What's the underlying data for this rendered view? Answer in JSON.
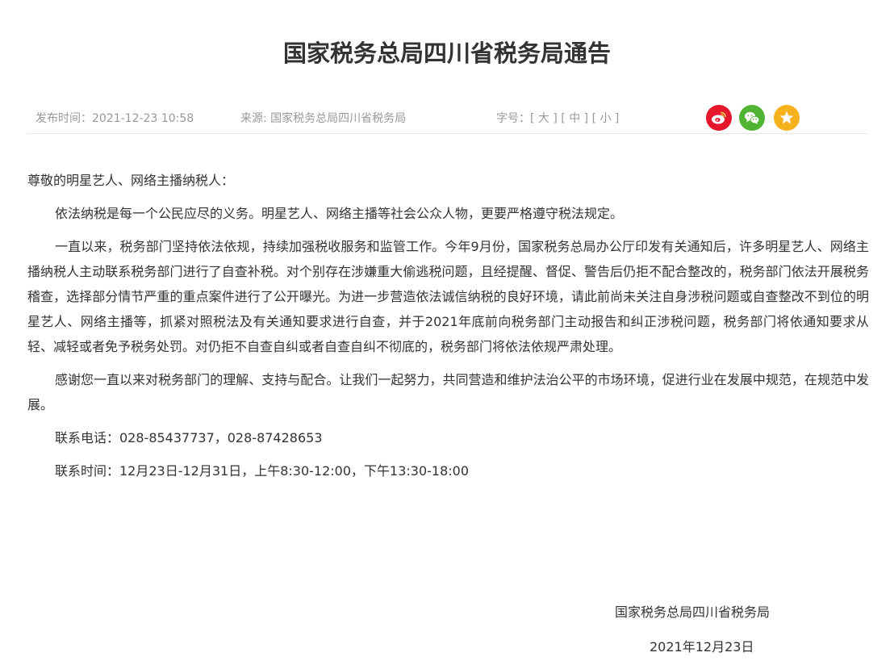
{
  "article": {
    "title": "国家税务总局四川省税务局通告"
  },
  "meta": {
    "publish_label": "发布时间：",
    "publish_time": "2021-12-23 10:58",
    "source_label": "来源: ",
    "source": "国家税务总局四川省税务局",
    "font_size_label": "字号：",
    "size_large": "[ 大 ]",
    "size_medium": "[ 中 ]",
    "size_small": "[ 小 ]"
  },
  "share": {
    "weibo_icon": "weibo-icon",
    "wechat_icon": "wechat-icon",
    "favorite_icon": "star-icon",
    "colors": {
      "weibo": "#e6162d",
      "wechat": "#51b332",
      "favorite": "#f5b21d"
    }
  },
  "body": {
    "greeting": "尊敬的明星艺人、网络主播纳税人：",
    "p1": "依法纳税是每一个公民应尽的义务。明星艺人、网络主播等社会公众人物，更要严格遵守税法规定。",
    "p2": "一直以来，税务部门坚持依法依规，持续加强税收服务和监管工作。今年9月份，国家税务总局办公厅印发有关通知后，许多明星艺人、网络主播纳税人主动联系税务部门进行了自查补税。对个别存在涉嫌重大偷逃税问题，且经提醒、督促、警告后仍拒不配合整改的，税务部门依法开展税务稽查，选择部分情节严重的重点案件进行了公开曝光。为进一步营造依法诚信纳税的良好环境，请此前尚未关注自身涉税问题或自查整改不到位的明星艺人、网络主播等，抓紧对照税法及有关通知要求进行自查，并于2021年底前向税务部门主动报告和纠正涉税问题，税务部门将依通知要求从轻、减轻或者免予税务处罚。对仍拒不自查自纠或者自查自纠不彻底的，税务部门将依法依规严肃处理。",
    "p3": "感谢您一直以来对税务部门的理解、支持与配合。让我们一起努力，共同营造和维护法治公平的市场环境，促进行业在发展中规范，在规范中发展。",
    "phone": "联系电话：028-85437737，028-87428653",
    "hours": "联系时间：12月23日-12月31日，上午8:30-12:00，下午13:30-18:00"
  },
  "signature": {
    "org": "国家税务总局四川省税务局",
    "date": "2021年12月23日"
  }
}
